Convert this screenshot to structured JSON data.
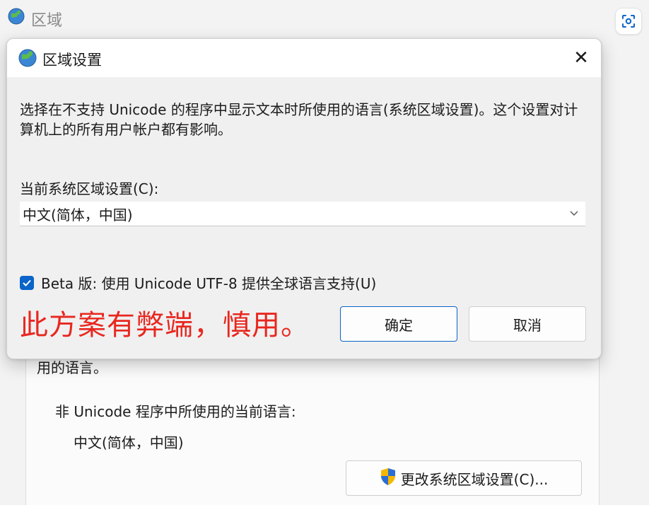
{
  "background_window": {
    "title": "区域",
    "title_icon": "globe-icon",
    "scan_icon": "screenshot-scan-icon",
    "text_partial": "用的语言。",
    "non_unicode_label": "非 Unicode 程序中所使用的当前语言:",
    "current_language": "中文(简体，中国)",
    "change_button_label": "更改系统区域设置(C)...",
    "change_button_icon": "uac-shield-icon"
  },
  "dialog": {
    "title": "区域设置",
    "title_icon": "globe-icon",
    "close_glyph": "✕",
    "description": "选择在不支持 Unicode 的程序中显示文本时所使用的语言(系统区域设置)。这个设置对计算机上的所有用户帐户都有影响。",
    "current_locale_label": "当前系统区域设置(C):",
    "current_locale_value": "中文(简体，中国)",
    "beta_checkbox": {
      "checked": true,
      "label": "Beta 版: 使用 Unicode UTF-8 提供全球语言支持(U)"
    },
    "annotation": "此方案有弊端，慎用。",
    "ok_label": "确定",
    "cancel_label": "取消"
  },
  "colors": {
    "accent": "#0b64c9",
    "annotation": "#e8271f"
  }
}
